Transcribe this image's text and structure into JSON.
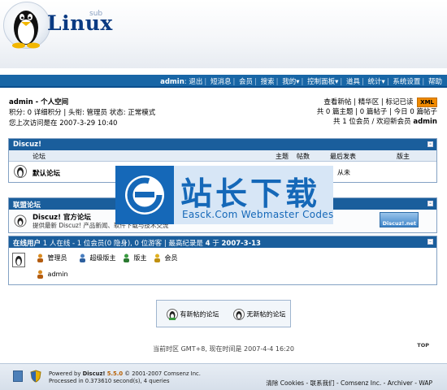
{
  "logo": {
    "text": "Linux",
    "sub": "sub"
  },
  "nav": {
    "user": "admin",
    "items": [
      "退出",
      "短消息",
      "会员",
      "搜索",
      "我的▾",
      "控制面板▾",
      "道具",
      "统计▾",
      "系统设置",
      "帮助"
    ]
  },
  "user_info": {
    "title": "admin - 个人空间",
    "row2": "积分: 0 详细积分 | 头衔: 管理员 状态: 正常模式",
    "row3": "您上次访问是在 2007-3-29 10:40"
  },
  "side_info": {
    "links": "查看新帖 | 精华区 | 标记已读",
    "xml": "XML",
    "stats1": "共 0 篇主题 | 0 篇帖子 | 今日 0 篇帖子",
    "stats2_prefix": "共 1 位会员 / 欢迎新会员",
    "new_member": "admin"
  },
  "discuz_table": {
    "title": "Discuz!",
    "columns": {
      "forum": "论坛",
      "topics": "主题",
      "posts": "帖数",
      "last": "最后发表",
      "mod": "版主"
    },
    "rows": [
      {
        "name": "默认论坛",
        "last": "从未"
      }
    ]
  },
  "watermark": {
    "title": "站长下载",
    "sub": "Easck.Com Webmaster Codes"
  },
  "league": {
    "title": "联盟论坛",
    "name": "Discuz! 官方论坛",
    "desc": "提供最新 Discuz! 产品新闻、软件下载与技术交流",
    "badge": "Discuz!.net"
  },
  "online": {
    "label": "在线用户",
    "count_text": "1 人在线 - 1 位会员(0 隐身), 0 位游客 | 最高纪录是",
    "record": "4",
    "on_text": "于",
    "record_date": "2007-3-13",
    "legend": [
      "管理员",
      "超级版主",
      "版主",
      "会员"
    ],
    "users": [
      "admin"
    ]
  },
  "icon_legend": {
    "new": "有新帖的论坛",
    "no_new": "无新帖的论坛"
  },
  "timezone": "当前时区 GMT+8, 现在时间是 2007-4-4 16:20",
  "top_link": "TOP",
  "footer": {
    "powered": "Powered by",
    "product": "Discuz!",
    "version": "5.5.0",
    "copyright": "© 2001-2007 Comsenz Inc.",
    "processed": "Processed in 0.373610 second(s), 4 queries",
    "links": "清除 Cookies - 联系我们 - Comsenz Inc. - Archiver - WAP"
  },
  "colors": {
    "header_bar": "#1866a6",
    "table_head": "#1a5e9c",
    "watermark": "#1568b8"
  }
}
